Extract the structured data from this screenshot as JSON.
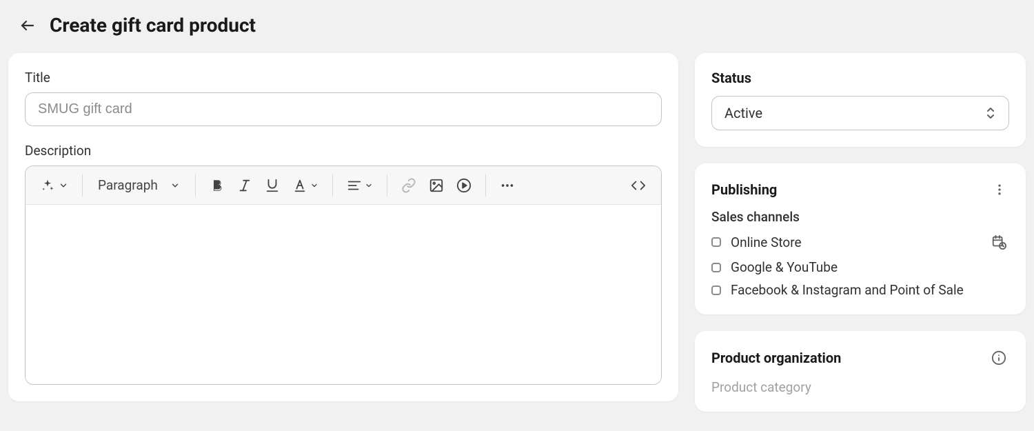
{
  "header": {
    "title": "Create gift card product"
  },
  "main": {
    "title_label": "Title",
    "title_placeholder": "SMUG gift card",
    "description_label": "Description",
    "toolbar": {
      "paragraph": "Paragraph"
    }
  },
  "status": {
    "heading": "Status",
    "value": "Active"
  },
  "publishing": {
    "heading": "Publishing",
    "sales_channels_label": "Sales channels",
    "channels": [
      {
        "label": "Online Store"
      },
      {
        "label": "Google & YouTube"
      },
      {
        "label": "Facebook & Instagram and Point of Sale"
      }
    ]
  },
  "organization": {
    "heading": "Product organization",
    "category_label": "Product category"
  }
}
